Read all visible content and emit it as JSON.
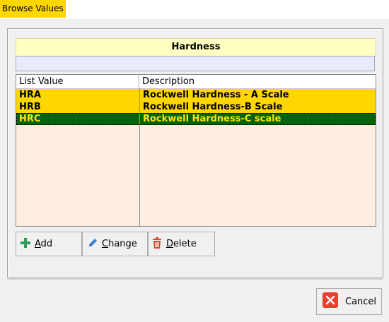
{
  "window": {
    "title": "Browse Values"
  },
  "panel": {
    "heading": "Hardness",
    "filter_value": ""
  },
  "grid": {
    "columns": [
      "List Value",
      "Description"
    ],
    "rows": [
      {
        "value": "HRA",
        "description": "Rockwell Hardness - A Scale",
        "selected": false
      },
      {
        "value": "HRB",
        "description": "Rockwell Hardness-B Scale",
        "selected": false
      },
      {
        "value": "HRC",
        "description": "Rockwell Hardness-C scale",
        "selected": true
      }
    ],
    "colors": {
      "row_bg": "#ffd700",
      "selected_bg": "#00640a",
      "selected_text": "#ffe600",
      "empty_bg": "#fdece0"
    }
  },
  "buttons": {
    "add": {
      "label_underlined": "A",
      "label_rest": "dd",
      "icon": "plus-icon"
    },
    "change": {
      "label_underlined": "C",
      "label_rest": "hange",
      "icon": "pencil-icon"
    },
    "delete": {
      "label_underlined": "D",
      "label_rest": "elete",
      "icon": "trash-icon"
    },
    "cancel": {
      "label": "Cancel",
      "icon": "close-icon"
    }
  }
}
